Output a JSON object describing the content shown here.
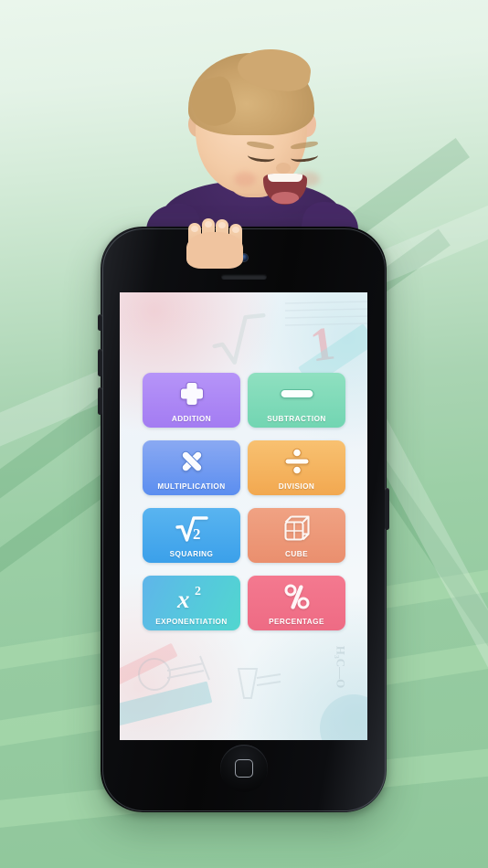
{
  "background": {
    "type": "green-striped-gradient",
    "top_color": "#eaf6ec",
    "bottom_color": "#8fc79b",
    "stripe_color": "#3c8c55"
  },
  "photo": {
    "subject": "laughing-toddler-holding-phone",
    "hair_color": "#c8a169",
    "shirt_color": "#432861",
    "skin_color": "#f3cba6"
  },
  "device": {
    "name": "iphone",
    "body_color": "#070708",
    "camera": "front-camera",
    "speaker": "earpiece-speaker",
    "home_button": "home-button",
    "buttons": [
      "silent-switch",
      "volume-up",
      "volume-down",
      "power-button"
    ]
  },
  "app": {
    "wallpaper": {
      "style": "pastel-math-science-doodles",
      "motif_digit": "1",
      "base_color": "#eef4f9"
    },
    "menu": {
      "tiles": [
        {
          "label": "ADDITION",
          "icon": "plus-icon",
          "color_top": "#b694f8",
          "color_bottom": "#a37cf2"
        },
        {
          "label": "SUBTRACTION",
          "icon": "minus-icon",
          "color_top": "#8fe0c0",
          "color_bottom": "#72d5b2"
        },
        {
          "label": "MULTIPLICATION",
          "icon": "multiply-icon",
          "color_top": "#8aa9f2",
          "color_bottom": "#5b8ef0"
        },
        {
          "label": "DIVISION",
          "icon": "divide-icon",
          "color_top": "#f8c171",
          "color_bottom": "#f2a850"
        },
        {
          "label": "SQUARING",
          "icon": "square-root-icon",
          "color_top": "#59b4f0",
          "color_bottom": "#3ba0ea"
        },
        {
          "label": "CUBE",
          "icon": "cube-icon",
          "color_top": "#f0a283",
          "color_bottom": "#ea8f6e"
        },
        {
          "label": "EXPONENTIATION",
          "icon": "exponent-icon",
          "color_top": "#5fc3e8",
          "color_bottom": "#52d4d0"
        },
        {
          "label": "PERCENTAGE",
          "icon": "percent-icon",
          "color_top": "#f4798f",
          "color_bottom": "#ee6b84"
        }
      ]
    }
  }
}
